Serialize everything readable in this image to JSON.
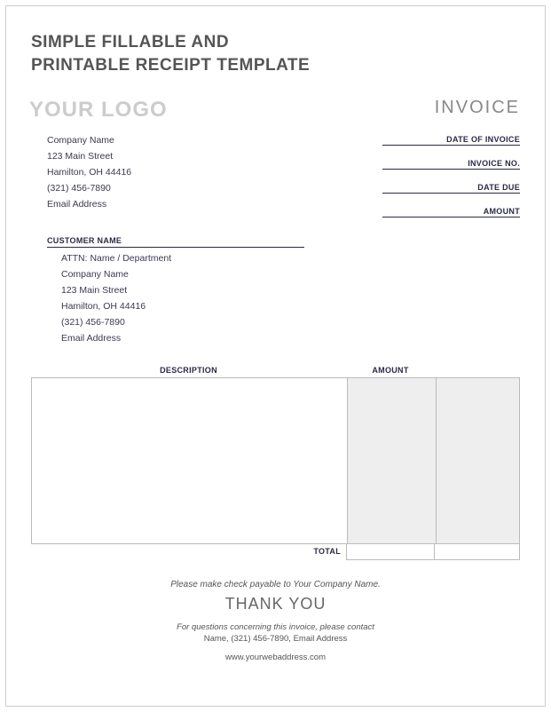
{
  "title": "SIMPLE FILLABLE AND\nPRINTABLE RECEIPT TEMPLATE",
  "logo": "YOUR LOGO",
  "invoiceWord": "INVOICE",
  "from": {
    "company": "Company Name",
    "street": "123 Main Street",
    "cityline": "Hamilton, OH  44416",
    "phone": "(321) 456-7890",
    "email": "Email Address"
  },
  "meta": {
    "dateOfInvoice": "DATE OF INVOICE",
    "invoiceNo": "INVOICE NO.",
    "dateDue": "DATE DUE",
    "amount": "AMOUNT"
  },
  "customerHeader": "CUSTOMER NAME",
  "customer": {
    "attn": "ATTN: Name / Department",
    "company": "Company Name",
    "street": "123 Main Street",
    "cityline": "Hamilton, OH  44416",
    "phone": "(321) 456-7890",
    "email": "Email Address"
  },
  "table": {
    "descHeader": "DESCRIPTION",
    "amountHeader": "AMOUNT",
    "totalLabel": "TOTAL"
  },
  "footer": {
    "payable": "Please make check payable to Your Company Name.",
    "thankyou": "THANK YOU",
    "contactLine": "For questions concerning this invoice, please contact",
    "contactInfo": "Name, (321) 456-7890, Email Address",
    "web": "www.yourwebaddress.com"
  }
}
